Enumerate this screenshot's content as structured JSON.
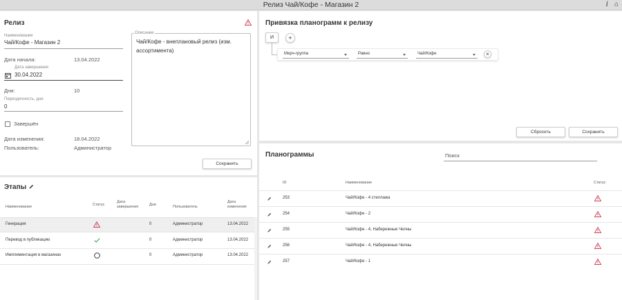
{
  "window": {
    "title": "Релиз Чай/Кофе - Магазин 2",
    "info_icon": "i",
    "home_icon": "⌂"
  },
  "release": {
    "title": "Релиз",
    "name_label": "Наименование",
    "name_value": "Чай/Кофе - Магазин 2",
    "start_label": "Дата начала:",
    "start_value": "13.04.2022",
    "end_label": "Дата завершения",
    "end_value": "30.04.2022",
    "days_label": "Дни:",
    "days_value": "10",
    "period_label": "Периодичность, дни",
    "period_value": "0",
    "completed_label": "Завершён",
    "changed_label": "Дата изменения:",
    "changed_value": "18.04.2022",
    "user_label": "Пользователь:",
    "user_value": "Администратор",
    "desc_label": "Описание",
    "desc_value": "Чай/Кофе - внеплановый релиз (изм. ассортимента)",
    "save_label": "Сохранить"
  },
  "stages": {
    "title": "Этапы",
    "columns": [
      "Наименование",
      "Статус",
      "Дата завершения",
      "Дни",
      "Пользователь",
      "Дата изменения"
    ],
    "rows": [
      {
        "name": "Генерация",
        "status": "warning",
        "end": "",
        "days": "0",
        "user": "Администратор",
        "changed": "13.04.2022"
      },
      {
        "name": "Перевод в публикацию",
        "status": "done",
        "end": "",
        "days": "0",
        "user": "Администратор",
        "changed": "13.04.2022"
      },
      {
        "name": "Имплиментация в магазинах",
        "status": "pending",
        "end": "",
        "days": "0",
        "user": "Администратор",
        "changed": "13.04.2022"
      }
    ]
  },
  "binding": {
    "title": "Привязка планограмм к релизу",
    "and_label": "И",
    "plus_label": "+",
    "field_value": "Мерч-группа",
    "operator_value": "Равно",
    "filter_value": "Чай/Кофе",
    "clear_label": "×",
    "reset_label": "Сбросить",
    "save_label": "Сохранить"
  },
  "planograms": {
    "title": "Планограммы",
    "search_placeholder": "Поиск",
    "columns": [
      "ID",
      "Наименование",
      "Статус"
    ],
    "rows": [
      {
        "id": "253",
        "name": "Чай/Кофе - 4 стеллажа",
        "status": "warning"
      },
      {
        "id": "254",
        "name": "Чай/Кофе - 2",
        "status": "warning"
      },
      {
        "id": "255",
        "name": "Чай/Кофе - 4, Набережные Челны",
        "status": "warning"
      },
      {
        "id": "256",
        "name": "Чай/Кофе - 4, Набережные Челны",
        "status": "warning"
      },
      {
        "id": "257",
        "name": "Чай/Кофе - 1",
        "status": "warning"
      }
    ]
  },
  "colors": {
    "warning": "#d0475d",
    "success": "#3aa14a",
    "row_highlight": "#efefef"
  }
}
